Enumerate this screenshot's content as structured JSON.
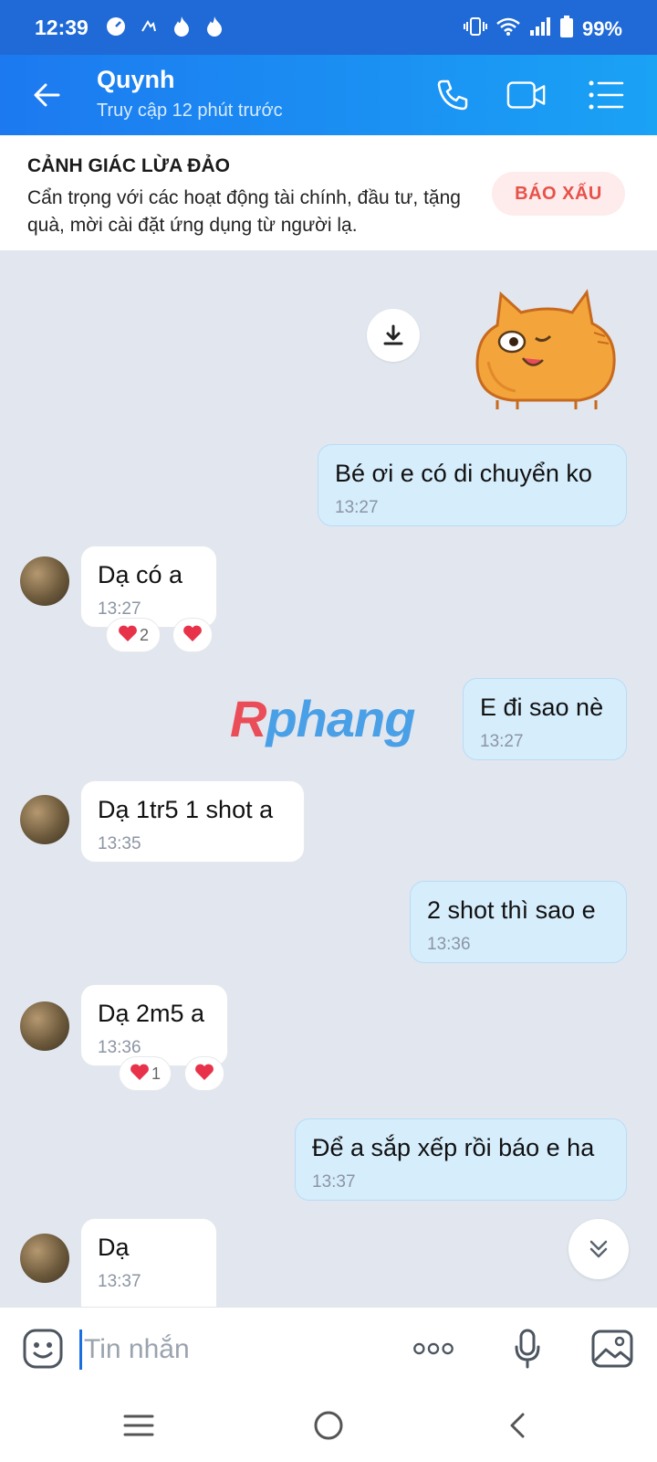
{
  "status_bar": {
    "time": "12:39",
    "battery": "99%"
  },
  "header": {
    "contact_name": "Quynh",
    "last_seen": "Truy cập 12 phút trước"
  },
  "warning": {
    "title": "CẢNH GIÁC LỪA ĐẢO",
    "text": "Cẩn trọng với các hoạt động tài chính, đầu tư, tặng quà, mời cài đặt ứng dụng từ người lạ.",
    "report_label": "BÁO XẤU"
  },
  "messages": [
    {
      "direction": "out",
      "text": "Bé ơi e có di chuyển ko",
      "time": "13:27"
    },
    {
      "direction": "in",
      "text": "Dạ có a",
      "time": "13:27",
      "reaction_count": "2"
    },
    {
      "direction": "out",
      "text": "E đi sao nè",
      "time": "13:27"
    },
    {
      "direction": "in",
      "text": "Dạ 1tr5 1 shot a",
      "time": "13:35"
    },
    {
      "direction": "out",
      "text": "2 shot thì sao e",
      "time": "13:36"
    },
    {
      "direction": "in",
      "text": "Dạ 2m5 a",
      "time": "13:36",
      "reaction_count": "1"
    },
    {
      "direction": "out",
      "text": "Để a sắp xếp rồi báo e ha",
      "time": "13:37"
    },
    {
      "direction": "in",
      "text": "Dạ",
      "time": "13:37"
    }
  ],
  "watermark": {
    "part1": "R",
    "part2": "phang"
  },
  "input": {
    "placeholder": "Tin nhắn"
  },
  "colors": {
    "header_start": "#1c79f0",
    "header_end": "#1aa2f5",
    "outgoing_bubble": "#d6edfc",
    "incoming_bubble": "#ffffff",
    "report_red": "#e8514a",
    "chat_bg": "#e1e6ef"
  },
  "icons": {
    "header": [
      "back-arrow-icon",
      "phone-icon",
      "video-call-icon",
      "menu-list-icon"
    ],
    "input": [
      "emoji-icon",
      "more-icon",
      "microphone-icon",
      "image-icon"
    ],
    "nav": [
      "recent-apps-icon",
      "home-icon",
      "back-icon"
    ]
  }
}
